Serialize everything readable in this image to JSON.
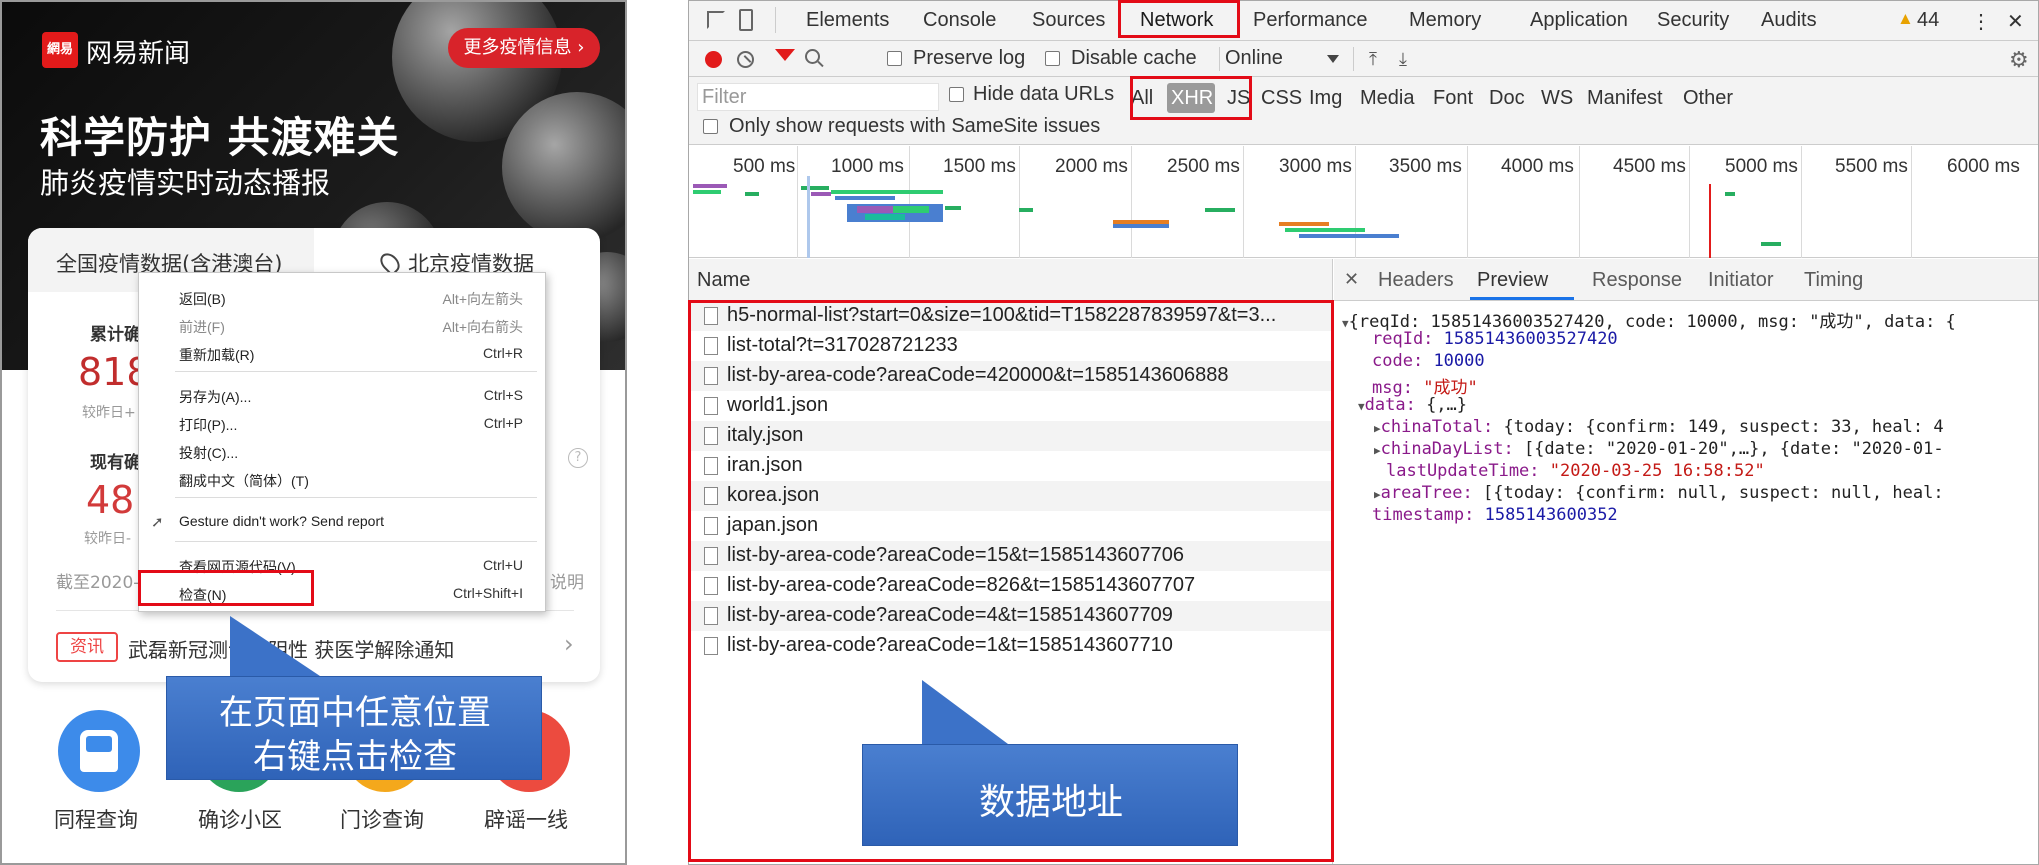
{
  "phone": {
    "logo_mark": "網易",
    "logo_text": "网易新闻",
    "more_button": "更多疫情信息 ›",
    "hero_title": "科学防护 共渡难关",
    "hero_subtitle": "肺炎疫情实时动态播报",
    "card": {
      "tab_national": "全国疫情数据(含港澳台)",
      "tab_beijing": "北京疫情数据",
      "stat1_label": "累计确",
      "stat1_value": "818",
      "stat1_compare": "较昨日+",
      "stat2_label": "现有确",
      "stat2_value": "481",
      "stat2_compare": "较昨日-",
      "footer": "截至2020-",
      "footer_right": "说明",
      "help": "?",
      "news_tag": "资讯",
      "news_text": "武磊新冠测试呈阴性 获医学解除通知",
      "news_chevron": "›"
    },
    "shortcuts": [
      "同程查询",
      "确诊小区",
      "门诊查询",
      "辟谣一线"
    ]
  },
  "context_menu": {
    "items": [
      {
        "label": "返回(B)",
        "shortcut": "Alt+向左箭头"
      },
      {
        "label": "前进(F)",
        "shortcut": "Alt+向右箭头"
      },
      {
        "label": "重新加载(R)",
        "shortcut": "Ctrl+R"
      },
      {
        "label": "另存为(A)...",
        "shortcut": "Ctrl+S"
      },
      {
        "label": "打印(P)...",
        "shortcut": "Ctrl+P"
      },
      {
        "label": "投射(C)...",
        "shortcut": ""
      },
      {
        "label": "翻成中文（简体）(T)",
        "shortcut": ""
      },
      {
        "label": "Gesture didn't work? Send report",
        "shortcut": ""
      },
      {
        "label": "查看网页源代码(V)",
        "shortcut": "Ctrl+U"
      },
      {
        "label": "检查(N)",
        "shortcut": "Ctrl+Shift+I"
      }
    ]
  },
  "callouts": {
    "left_line1": "在页面中任意位置",
    "left_line2": "右键点击检查",
    "right": "数据地址"
  },
  "devtools": {
    "tabs": [
      "Elements",
      "Console",
      "Sources",
      "Network",
      "Performance",
      "Memory",
      "Application",
      "Security",
      "Audits"
    ],
    "active_tab": "Network",
    "warning_count": "44",
    "close_icon_label": "✕",
    "menu_icon_label": "⋮",
    "toolbar": {
      "preserve_log": "Preserve log",
      "disable_cache": "Disable cache",
      "throttle": "Online"
    },
    "filter": {
      "placeholder": "Filter",
      "hide_data_urls": "Hide data URLs",
      "types": [
        "All",
        "XHR",
        "JS",
        "CSS",
        "Img",
        "Media",
        "Font",
        "Doc",
        "WS",
        "Manifest",
        "Other"
      ],
      "active_type": "XHR",
      "samesite": "Only show requests with SameSite issues"
    },
    "overview_ticks": [
      "500 ms",
      "1000 ms",
      "1500 ms",
      "2000 ms",
      "2500 ms",
      "3000 ms",
      "3500 ms",
      "4000 ms",
      "4500 ms",
      "5000 ms",
      "5500 ms",
      "6000 ms"
    ],
    "name_header": "Name",
    "requests": [
      "h5-normal-list?start=0&size=100&tid=T1582287839597&t=3...",
      "list-total?t=317028721233",
      "list-by-area-code?areaCode=420000&t=1585143606888",
      "world1.json",
      "italy.json",
      "iran.json",
      "korea.json",
      "japan.json",
      "list-by-area-code?areaCode=15&t=1585143607706",
      "list-by-area-code?areaCode=826&t=1585143607707",
      "list-by-area-code?areaCode=4&t=1585143607709",
      "list-by-area-code?areaCode=1&t=1585143607710"
    ],
    "preview_tabs": [
      "Headers",
      "Preview",
      "Response",
      "Initiator",
      "Timing"
    ],
    "active_preview_tab": "Preview",
    "preview": {
      "summary": "{reqId: 15851436003527420, code: 10000, msg: \"成功\", data: {",
      "reqId_key": "reqId:",
      "reqId_val": "15851436003527420",
      "code_key": "code:",
      "code_val": "10000",
      "msg_key": "msg:",
      "msg_val": "\"成功\"",
      "data_key": "data:",
      "data_val": "{,…}",
      "chinaTotal_key": "chinaTotal:",
      "chinaTotal_val": "{today: {confirm: 149, suspect: 33, heal: 4",
      "chinaDayList_key": "chinaDayList:",
      "chinaDayList_val": "[{date: \"2020-01-20\",…}, {date: \"2020-01-",
      "lastUpdateTime_key": "lastUpdateTime:",
      "lastUpdateTime_val": "\"2020-03-25 16:58:52\"",
      "areaTree_key": "areaTree:",
      "areaTree_val": "[{today: {confirm: null, suspect: null, heal:",
      "timestamp_key": "timestamp:",
      "timestamp_val": "1585143600352"
    }
  },
  "colors": {
    "highlight_red": "#e30b17",
    "callout_blue": "#3a6ec4",
    "netease_red": "#d8232a"
  }
}
